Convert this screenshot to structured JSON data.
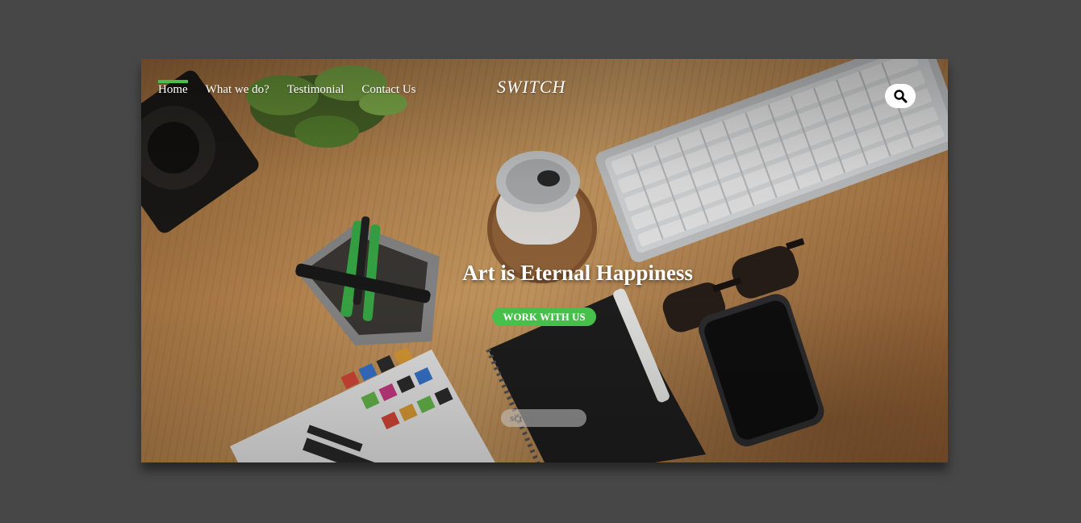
{
  "nav": {
    "items": [
      {
        "label": "Home",
        "active": true
      },
      {
        "label": "What we do?",
        "active": false
      },
      {
        "label": "Testimonial",
        "active": false
      },
      {
        "label": "Contact Us",
        "active": false
      }
    ]
  },
  "brand": {
    "logo": "SWITCH"
  },
  "search": {
    "icon": "search-icon"
  },
  "hero": {
    "headline": "Art is Eternal Happiness",
    "cta_label": "WORK WITH US",
    "scroll_label": "scroll down",
    "scroll_icon": "arrow-down-icon"
  },
  "colors": {
    "accent": "#46c04b",
    "page_background": "#474747",
    "text": "#ffffff"
  }
}
